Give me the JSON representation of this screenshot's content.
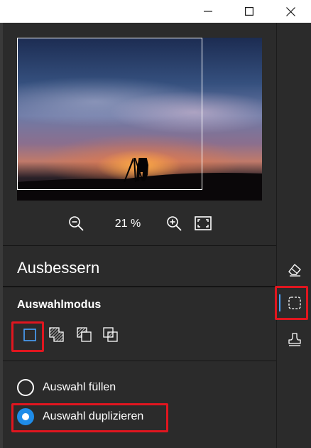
{
  "window": {
    "controls": [
      "minimize-icon",
      "maximize-icon",
      "close-icon"
    ]
  },
  "preview": {
    "image_description_icon": "photo-thumbnail",
    "zoom": {
      "value": "21 %",
      "zoom_out_icon": "zoom-out-icon",
      "zoom_in_icon": "zoom-in-icon",
      "fit_icon": "fit-to-screen-icon"
    }
  },
  "panel": {
    "title": "Ausbessern",
    "selection_mode": {
      "label": "Auswahlmodus",
      "modes": [
        "new-selection-icon",
        "add-selection-icon",
        "subtract-selection-icon",
        "intersect-selection-icon"
      ],
      "selected_index": 0
    },
    "options": [
      {
        "label": "Auswahl füllen",
        "checked": false
      },
      {
        "label": "Auswahl duplizieren",
        "checked": true
      }
    ]
  },
  "toolbar": {
    "tools": [
      "eraser-icon",
      "selection-tool-icon",
      "stamp-icon"
    ],
    "active_index": 1
  },
  "colors": {
    "panel_bg": "#2b2b2b",
    "accent": "#1f8ce8",
    "highlight": "#e0161f"
  }
}
